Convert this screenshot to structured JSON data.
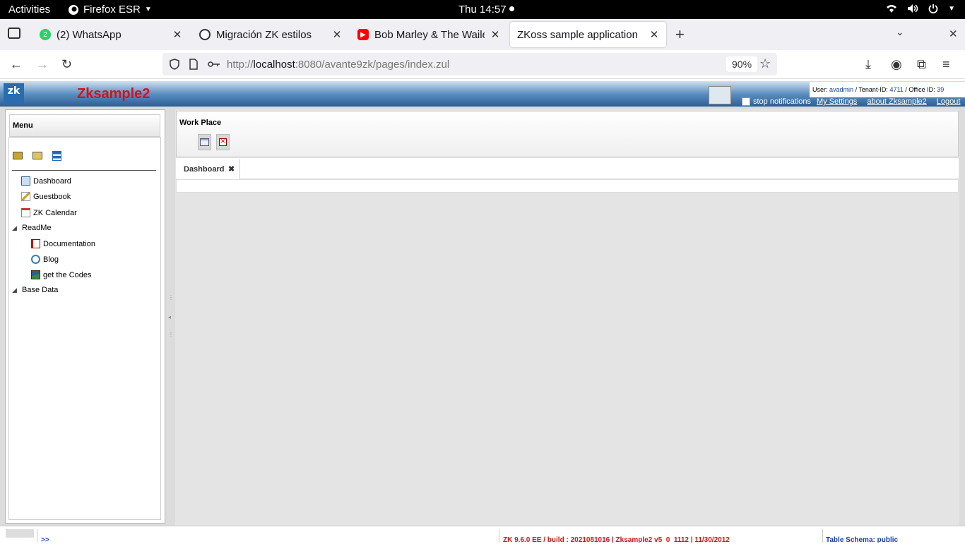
{
  "gnome": {
    "activities": "Activities",
    "app": "Firefox ESR",
    "clock": "Thu 14:57"
  },
  "browser": {
    "tabs": [
      {
        "title": "(2) WhatsApp",
        "badge": "2"
      },
      {
        "title": "Migración ZK estilos"
      },
      {
        "title": "Bob Marley & The Wailers"
      },
      {
        "title": "ZKoss sample application"
      }
    ],
    "url_prefix": "http://",
    "url_host": "localhost",
    "url_rest": ":8080/avante9zk/pages/index.zul",
    "zoom": "90%"
  },
  "zk": {
    "logo": "zk",
    "title": "Zksample2",
    "user_label": "User:",
    "user": "avadmin",
    "tenant_label": "/ Tenant-ID:",
    "tenant": "4711",
    "office_label": "/ Office ID:",
    "office": "39",
    "stop_notifications": "stop notifications",
    "my_settings": "My Settings",
    "about": "about Zksample2",
    "logout": "Logout"
  },
  "menu": {
    "title": "Menu",
    "items": [
      {
        "label": "Dashboard"
      },
      {
        "label": "Guestbook"
      },
      {
        "label": "ZK Calendar"
      },
      {
        "label": "ReadMe"
      },
      {
        "label": "Documentation"
      },
      {
        "label": "Blog"
      },
      {
        "label": "get the Codes"
      },
      {
        "label": "Base Data"
      }
    ]
  },
  "workplace": {
    "title": "Work Place",
    "tab": "Dashboard"
  },
  "status": {
    "arrow": ">>",
    "build": "ZK 9.6.0 EE / build : 2021081016 | Zksample2 v5_0_1112 | 11/30/2012",
    "schema": "Table Schema: public"
  },
  "colors": {
    "accent": "#2a5e95",
    "title_red": "#d2141a",
    "link_blue": "#1a3ea8"
  }
}
